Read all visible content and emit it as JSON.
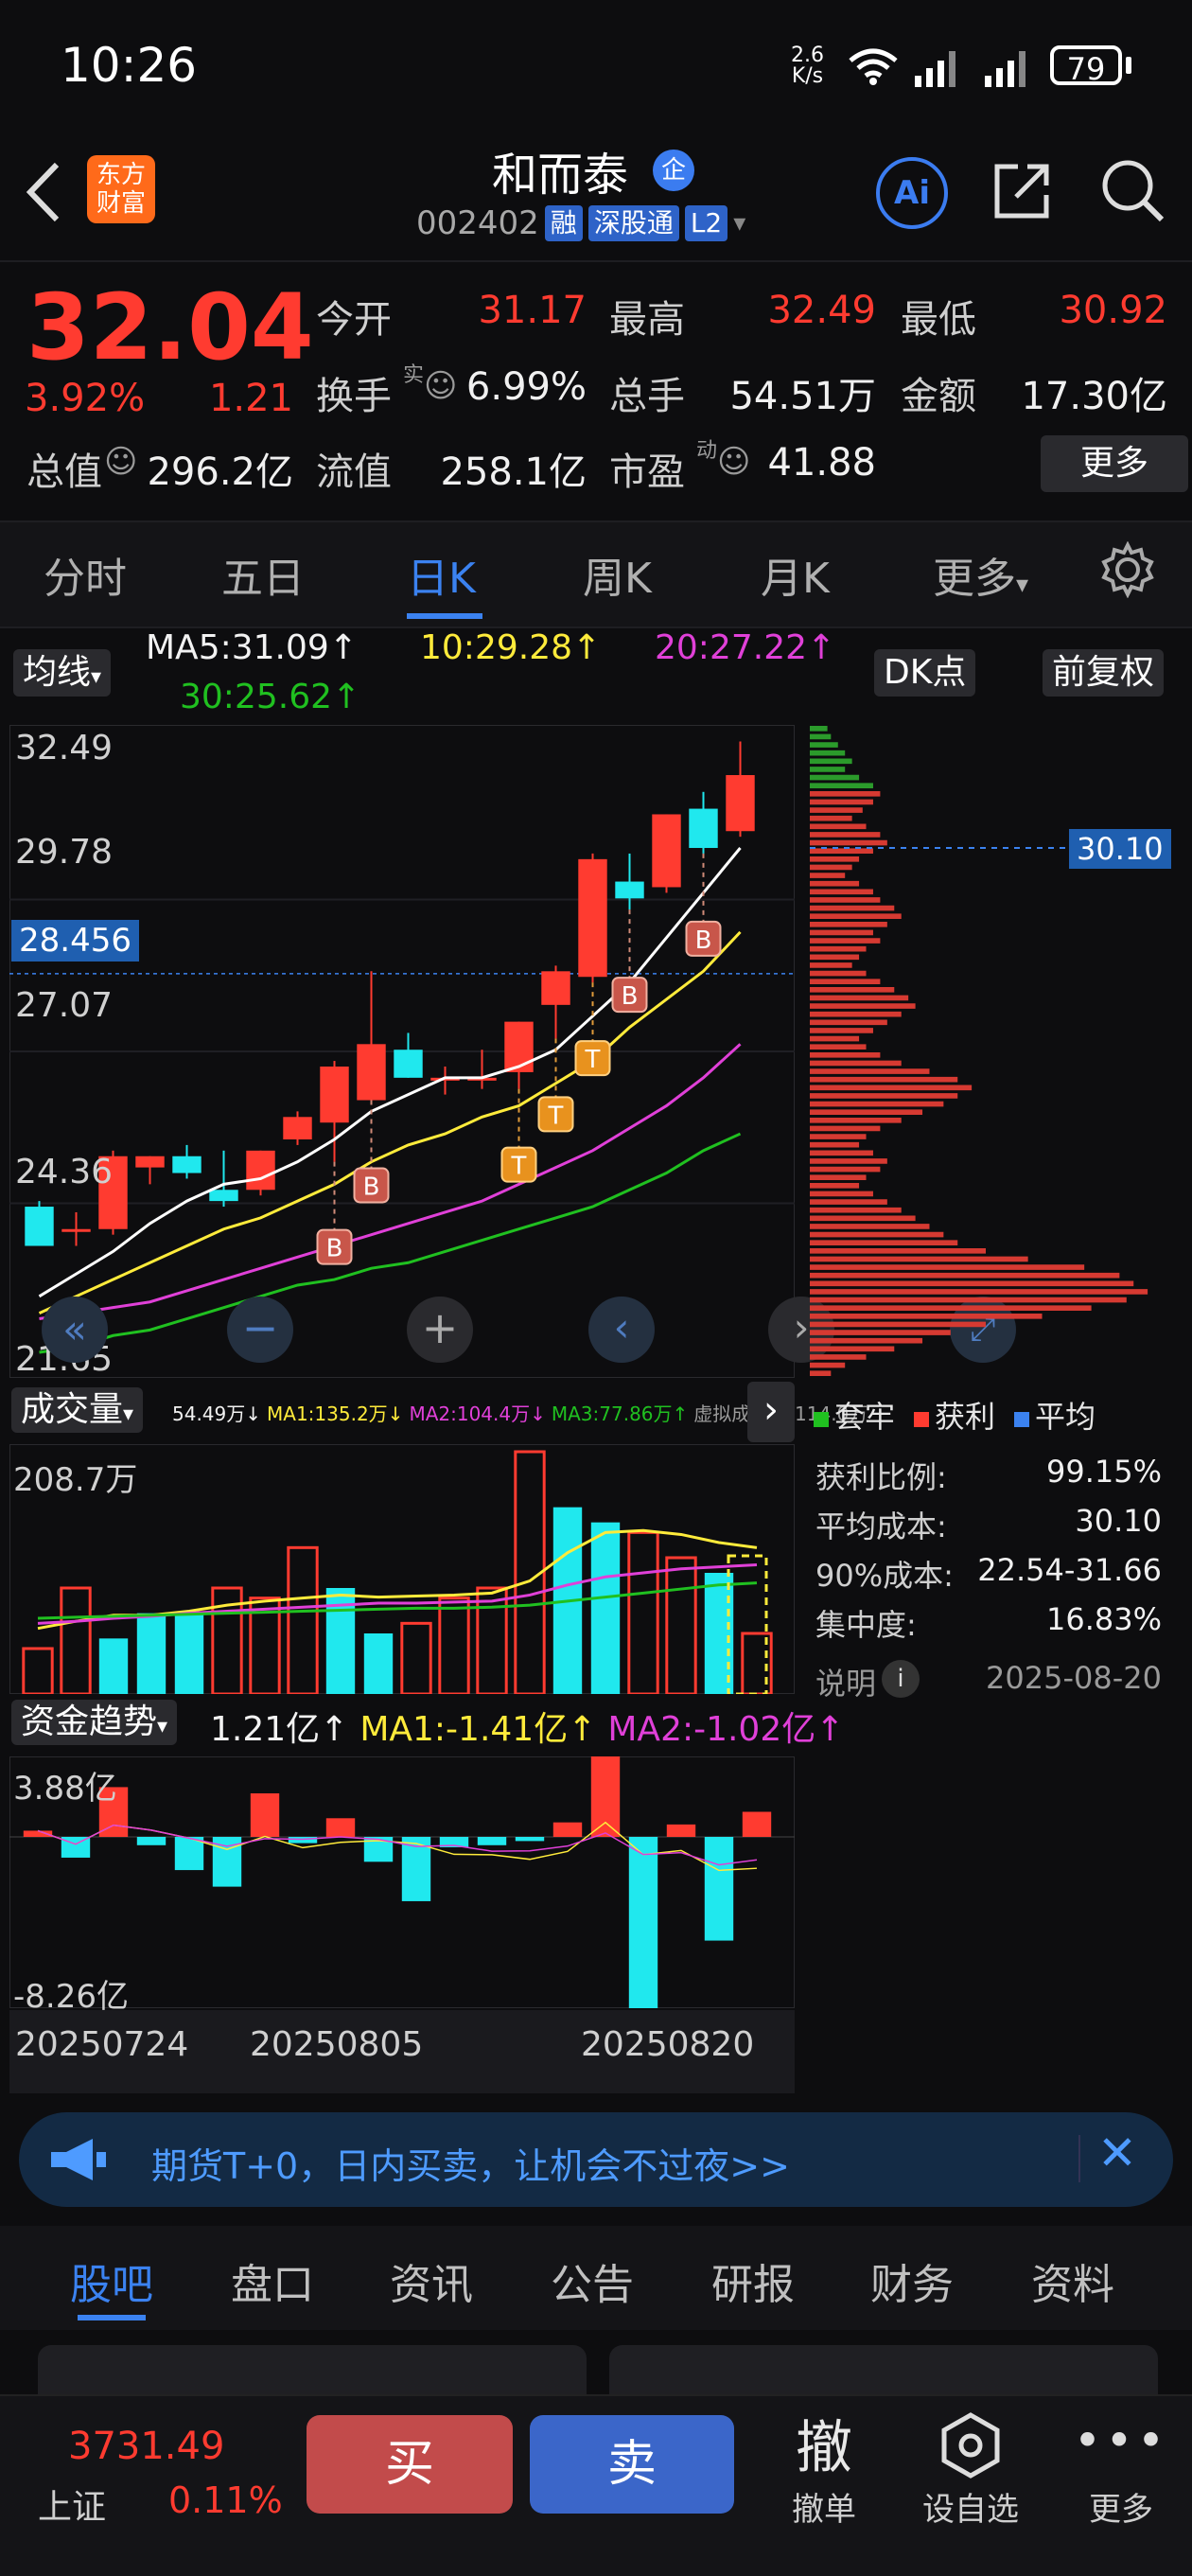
{
  "status_bar": {
    "time": "10:26",
    "net_speed_top": "2.6",
    "net_speed_bottom": "K/s",
    "battery": "79"
  },
  "header": {
    "logo_line1": "东方",
    "logo_line2": "财富",
    "stock_name": "和而泰",
    "badge": "企",
    "code": "002402",
    "tags": [
      "融",
      "深股通",
      "L2"
    ],
    "ai_label": "Ai"
  },
  "quote": {
    "price": "32.04",
    "change_pct": "3.92%",
    "change": "1.21",
    "rows": [
      [
        {
          "label": "今开",
          "value": "31.17",
          "color": "red"
        },
        {
          "label": "最高",
          "value": "32.49",
          "color": "red"
        },
        {
          "label": "最低",
          "value": "30.92",
          "color": "red"
        }
      ],
      [
        {
          "label": "换手",
          "value": "6.99%",
          "color": "white",
          "sup": "实"
        },
        {
          "label": "总手",
          "value": "54.51万",
          "color": "white"
        },
        {
          "label": "金额",
          "value": "17.30亿",
          "color": "white"
        }
      ]
    ],
    "total_value_label": "总值",
    "total_value": "296.2亿",
    "float_value_label": "流值",
    "float_value": "258.1亿",
    "pe_label": "市盈",
    "pe_sup": "动",
    "pe": "41.88",
    "more_label": "更多"
  },
  "tabs": [
    "分时",
    "五日",
    "日K",
    "周K",
    "月K",
    "更多"
  ],
  "active_tab": "日K",
  "ma_bar": {
    "selector": "均线",
    "ma5": "MA5:31.09↑",
    "ma10": "10:29.28↑",
    "ma20": "20:27.22↑",
    "ma30": "30:25.62↑",
    "dk_label": "DK点",
    "adjust_label": "前复权"
  },
  "colors": {
    "up": "#ff3b30",
    "down": "#20e8ee",
    "ma5": "#ffffff",
    "ma10": "#ffeb3b",
    "ma20": "#e040d8",
    "ma30": "#20c020",
    "accent": "#3b82f0"
  },
  "chart_data": [
    {
      "type": "candlestick",
      "y_ticks": [
        "32.49",
        "29.78",
        "27.07",
        "24.36",
        "21.65"
      ],
      "ylim": [
        21.65,
        32.49
      ],
      "marker_price": "28.456",
      "candles": [
        {
          "o": 24.3,
          "h": 24.4,
          "l": 23.6,
          "c": 23.6
        },
        {
          "o": 23.9,
          "h": 24.2,
          "l": 23.6,
          "c": 23.9
        },
        {
          "o": 23.9,
          "h": 25.3,
          "l": 23.8,
          "c": 25.2
        },
        {
          "o": 25.0,
          "h": 25.2,
          "l": 24.7,
          "c": 25.2
        },
        {
          "o": 25.2,
          "h": 25.4,
          "l": 24.8,
          "c": 24.9
        },
        {
          "o": 24.6,
          "h": 25.3,
          "l": 24.3,
          "c": 24.4
        },
        {
          "o": 24.6,
          "h": 25.3,
          "l": 24.5,
          "c": 25.3
        },
        {
          "o": 25.5,
          "h": 26.0,
          "l": 25.4,
          "c": 25.9
        },
        {
          "o": 25.8,
          "h": 26.9,
          "l": 25.1,
          "c": 26.8
        },
        {
          "o": 26.2,
          "h": 28.5,
          "l": 26.2,
          "c": 27.2
        },
        {
          "o": 27.1,
          "h": 27.4,
          "l": 26.6,
          "c": 26.6
        },
        {
          "o": 26.6,
          "h": 26.8,
          "l": 26.3,
          "c": 26.6
        },
        {
          "o": 26.6,
          "h": 27.1,
          "l": 26.4,
          "c": 26.6
        },
        {
          "o": 26.7,
          "h": 27.6,
          "l": 26.4,
          "c": 27.6
        },
        {
          "o": 27.9,
          "h": 28.6,
          "l": 27.3,
          "c": 28.5
        },
        {
          "o": 28.4,
          "h": 30.6,
          "l": 28.3,
          "c": 30.5
        },
        {
          "o": 30.1,
          "h": 30.6,
          "l": 29.6,
          "c": 29.8
        },
        {
          "o": 30.0,
          "h": 31.3,
          "l": 29.9,
          "c": 31.3
        },
        {
          "o": 31.4,
          "h": 31.7,
          "l": 30.6,
          "c": 30.7
        },
        {
          "o": 31.0,
          "h": 32.6,
          "l": 30.9,
          "c": 32.0
        }
      ],
      "ma5": [
        22.7,
        23.1,
        23.5,
        24.0,
        24.4,
        24.7,
        24.8,
        25.1,
        25.5,
        26.0,
        26.3,
        26.6,
        26.6,
        26.8,
        27.1,
        27.7,
        28.3,
        29.1,
        29.9,
        30.7
      ],
      "ma10": [
        22.4,
        22.7,
        23.0,
        23.3,
        23.6,
        23.9,
        24.1,
        24.4,
        24.7,
        25.1,
        25.4,
        25.6,
        25.9,
        26.1,
        26.5,
        26.9,
        27.5,
        28.0,
        28.5,
        29.2
      ],
      "ma20": [
        22.3,
        22.4,
        22.5,
        22.6,
        22.8,
        23.0,
        23.2,
        23.4,
        23.6,
        23.8,
        24.0,
        24.2,
        24.4,
        24.7,
        25.0,
        25.3,
        25.7,
        26.1,
        26.6,
        27.2
      ],
      "ma30": [
        21.7,
        21.8,
        22.0,
        22.1,
        22.3,
        22.5,
        22.7,
        22.9,
        23.0,
        23.2,
        23.3,
        23.5,
        23.7,
        23.9,
        24.1,
        24.3,
        24.6,
        24.9,
        25.3,
        25.6
      ],
      "signals": [
        {
          "i": 8,
          "label": "B",
          "kind": "B"
        },
        {
          "i": 9,
          "label": "B",
          "kind": "B"
        },
        {
          "i": 13,
          "label": "T",
          "kind": "T"
        },
        {
          "i": 14,
          "label": "T",
          "kind": "T"
        },
        {
          "i": 15,
          "label": "T",
          "kind": "T"
        },
        {
          "i": 16,
          "label": "B",
          "kind": "B"
        },
        {
          "i": 18,
          "label": "B",
          "kind": "B"
        }
      ]
    },
    {
      "type": "bar",
      "title": "成交量",
      "y_top_label": "208.7万",
      "legend_text": [
        "54.49万↓",
        "MA1:135.2万↓",
        "MA2:104.4万↓",
        "MA3:77.86万↑",
        "虚拟成交量:114.0万"
      ],
      "values": [
        45,
        105,
        55,
        80,
        80,
        105,
        95,
        145,
        105,
        60,
        70,
        95,
        105,
        240,
        185,
        170,
        160,
        135,
        120,
        60
      ],
      "up": [
        true,
        true,
        false,
        false,
        false,
        true,
        true,
        true,
        false,
        false,
        true,
        true,
        true,
        true,
        false,
        false,
        true,
        true,
        false,
        true
      ],
      "ma_a": [
        65,
        72,
        78,
        78,
        82,
        88,
        92,
        95,
        98,
        96,
        97,
        98,
        100,
        112,
        140,
        160,
        162,
        158,
        150,
        145
      ],
      "ma_b": [
        70,
        72,
        75,
        77,
        80,
        82,
        84,
        86,
        88,
        90,
        90,
        91,
        92,
        98,
        108,
        116,
        120,
        124,
        126,
        128
      ],
      "ma_c": [
        75,
        76,
        77,
        78,
        79,
        80,
        81,
        82,
        83,
        84,
        85,
        85,
        86,
        88,
        92,
        96,
        100,
        104,
        108,
        110
      ]
    },
    {
      "type": "bar",
      "title": "资金趋势",
      "y_top_label": "3.88亿",
      "y_bottom_label": "-8.26亿",
      "header_text": [
        "1.21亿↑",
        "MA1:-1.41亿↑",
        "MA2:-1.02亿↑"
      ],
      "values": [
        0.3,
        -1.0,
        2.4,
        -0.4,
        -1.6,
        -2.4,
        2.1,
        -0.3,
        0.9,
        -1.2,
        -3.1,
        -0.5,
        -0.4,
        -0.2,
        0.7,
        3.88,
        -8.26,
        0.6,
        -5.0,
        1.21
      ],
      "x_ticks": [
        "20250724",
        "20250805",
        "20250820"
      ]
    }
  ],
  "chip": {
    "cost_label": "30.10",
    "legend": [
      {
        "name": "套牢",
        "color": "#20c020"
      },
      {
        "name": "获利",
        "color": "#ff3b30"
      },
      {
        "name": "平均",
        "color": "#3b82f0"
      }
    ],
    "stats": [
      {
        "label": "获利比例:",
        "value": "99.15%"
      },
      {
        "label": "平均成本:",
        "value": "30.10"
      },
      {
        "label": "90%成本:",
        "value": "22.54-31.66"
      },
      {
        "label": "集中度:",
        "value": "16.83%"
      }
    ],
    "note_label": "说明",
    "date": "2025-08-20",
    "profile": [
      0.05,
      0.06,
      0.08,
      0.1,
      0.12,
      0.1,
      0.14,
      0.18,
      0.2,
      0.18,
      0.15,
      0.12,
      0.16,
      0.2,
      0.22,
      0.18,
      0.14,
      0.12,
      0.1,
      0.14,
      0.18,
      0.2,
      0.24,
      0.26,
      0.22,
      0.18,
      0.2,
      0.16,
      0.14,
      0.12,
      0.16,
      0.2,
      0.24,
      0.28,
      0.3,
      0.26,
      0.22,
      0.18,
      0.14,
      0.16,
      0.2,
      0.26,
      0.34,
      0.42,
      0.46,
      0.42,
      0.38,
      0.32,
      0.26,
      0.2,
      0.16,
      0.14,
      0.18,
      0.22,
      0.2,
      0.16,
      0.14,
      0.18,
      0.22,
      0.26,
      0.3,
      0.34,
      0.38,
      0.42,
      0.5,
      0.62,
      0.78,
      0.88,
      0.92,
      0.96,
      0.9,
      0.8,
      0.66,
      0.5,
      0.4,
      0.32,
      0.24,
      0.16,
      0.1,
      0.06
    ]
  },
  "ad": {
    "text": "期货T+0，日内买卖，让机会不过夜>>"
  },
  "bottom_tabs": [
    "股吧",
    "盘口",
    "资讯",
    "公告",
    "研报",
    "财务",
    "资料"
  ],
  "active_bottom_tab": "股吧",
  "bottom_bar": {
    "index_value": "3731.49",
    "index_name": "上证",
    "index_pct": "0.11%",
    "buy": "买",
    "sell": "卖",
    "withdraw_icon": "撤",
    "withdraw_label": "撤单",
    "watch_label": "设自选",
    "more_label": "更多"
  }
}
